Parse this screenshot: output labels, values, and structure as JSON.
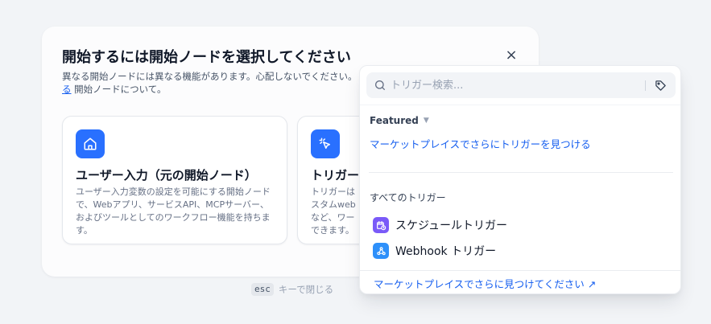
{
  "modal": {
    "title": "開始するには開始ノードを選択してください",
    "close_label": "×",
    "description_text": "異なる開始ノードには異なる機能があります。心配しないでください。",
    "description_link": "る",
    "description_suffix": " 開始ノードについて。"
  },
  "cards": [
    {
      "title": "ユーザー入力（元の開始ノード）",
      "description": "ユーザー入力変数の設定を可能にする開始ノードで、Webアプリ、サービスAPI、MCPサーバー、およびツールとしてのワークフロー機能を持ちます。",
      "icon": "home-icon",
      "color": "#2970ff"
    },
    {
      "title": "トリガー",
      "description": "トリガーはスタムwebなど、ワーできます。",
      "icon": "cursor-click-icon",
      "color": "#2970ff"
    }
  ],
  "esc_hint": {
    "key": "esc",
    "text": "キーで閉じる"
  },
  "dropdown": {
    "search_placeholder": "トリガー検索...",
    "featured_label": "Featured",
    "featured_link": "マーケットプレイスでさらにトリガーを見つける",
    "all_triggers_label": "すべてのトリガー",
    "triggers": [
      {
        "label": "スケジュールトリガー",
        "icon": "calendar-clock-icon",
        "color": "#7a5af8"
      },
      {
        "label": "Webhook トリガー",
        "icon": "webhook-icon",
        "color": "#2e90fa"
      }
    ],
    "footer_link": "マーケットプレイスでさらに見つけてください ↗"
  }
}
